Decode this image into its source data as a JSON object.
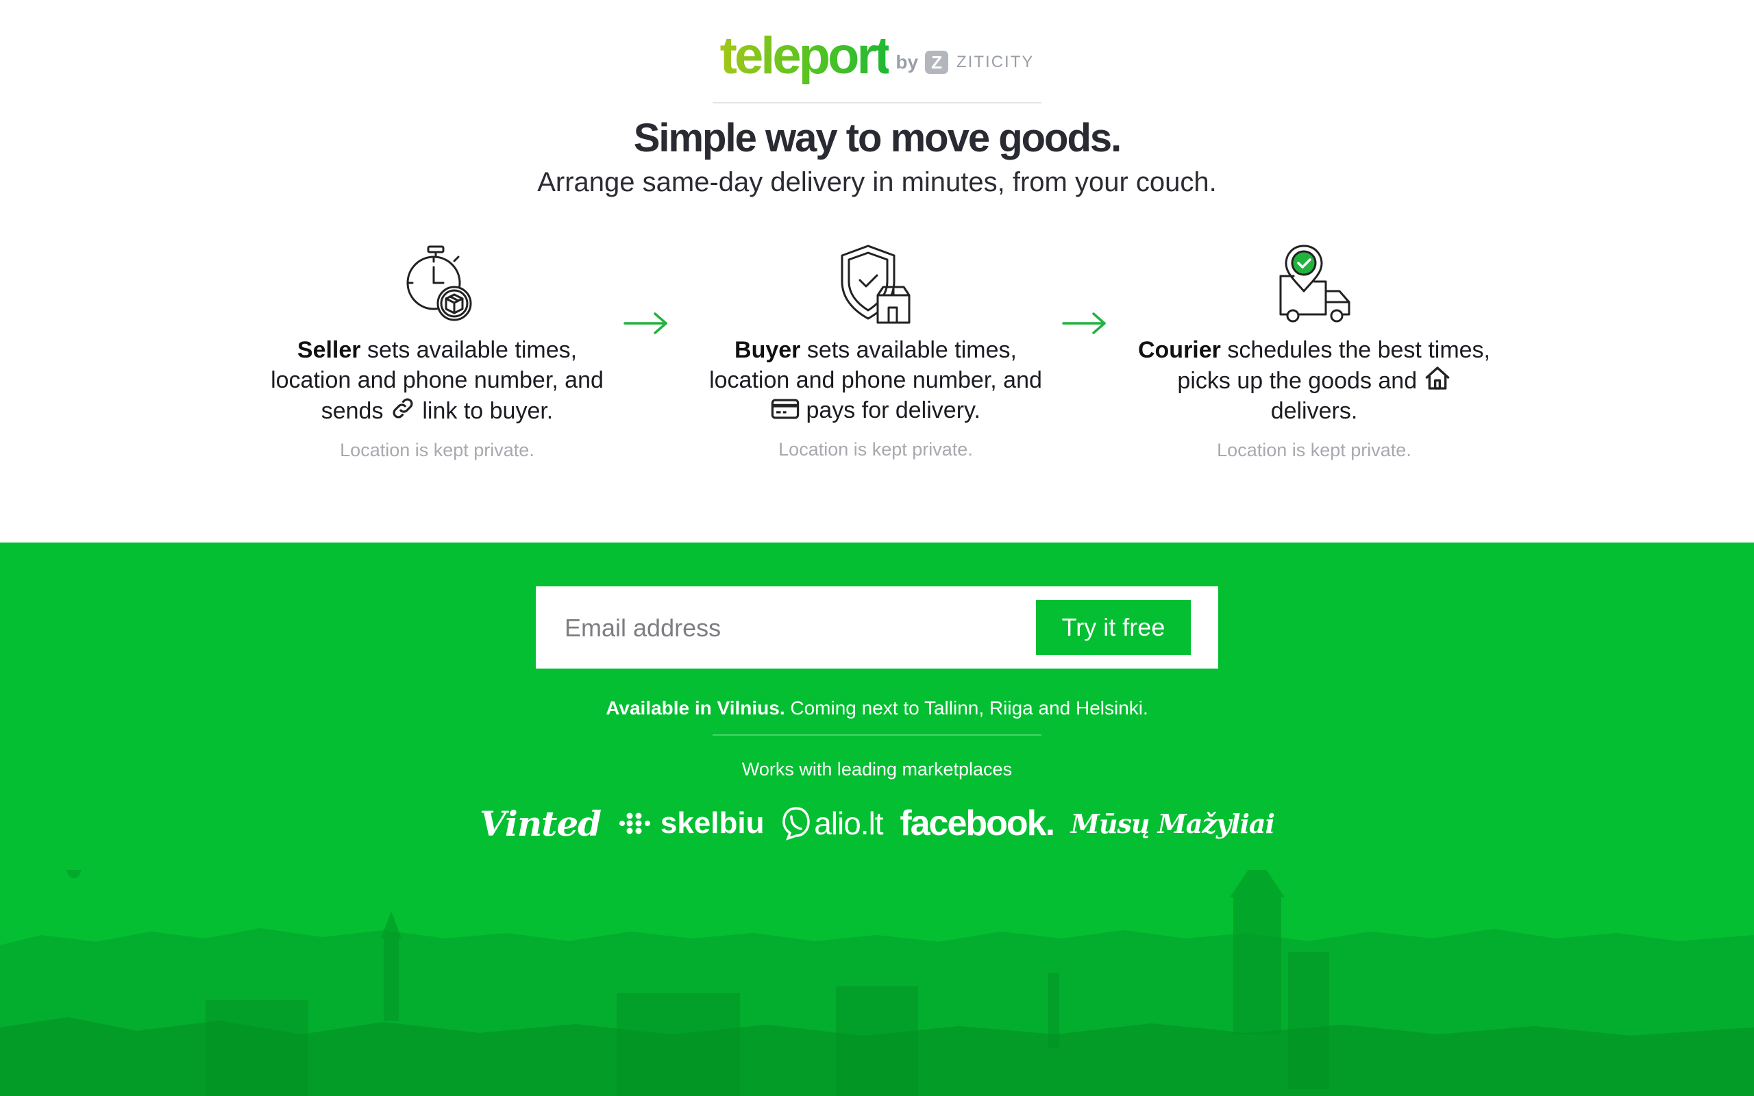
{
  "brand": {
    "logo_text": "teleport",
    "by_text": "by",
    "partner_mark": "Z",
    "partner_name": "ZITICITY",
    "logo_colors": [
      "#a4c617",
      "#1eb834"
    ]
  },
  "hero": {
    "headline": "Simple way to move goods.",
    "subheadline": "Arrange same-day delivery in minutes, from your couch."
  },
  "steps": [
    {
      "icon": "stopwatch-package-icon",
      "role": "Seller",
      "text_before_icon": " sets available times, location and phone number, and sends ",
      "inline_icon": "link-icon",
      "text_after_icon": " link to buyer.",
      "note": "Location is kept private."
    },
    {
      "icon": "shield-check-package-icon",
      "role": "Buyer",
      "text_before_icon": " sets available times, location and phone number, and ",
      "inline_icon": "credit-card-icon",
      "text_after_icon": " pays for delivery.",
      "note": "Location is kept private."
    },
    {
      "icon": "location-pin-truck-icon",
      "role": "Courier",
      "text_before_icon": " schedules the best times, picks up the goods and ",
      "inline_icon": "home-icon",
      "text_after_icon": " delivers.",
      "note": "Location is kept private."
    }
  ],
  "signup": {
    "email_placeholder": "Email address",
    "email_value": "",
    "button_label": "Try it free"
  },
  "availability": {
    "bold": "Available in Vilnius.",
    "rest": " Coming next to Tallinn, Riiga and Helsinki."
  },
  "marketplaces": {
    "heading": "Works with leading marketplaces",
    "logos": [
      "Vinted",
      "skelbiu",
      "alio.lt",
      "facebook.",
      "Mūsų Mažyliai"
    ]
  },
  "colors": {
    "accent_green": "#04bf31",
    "arrow_green": "#22b33f",
    "text_dark": "#2a2a33",
    "note_gray": "#a7a9ae"
  }
}
